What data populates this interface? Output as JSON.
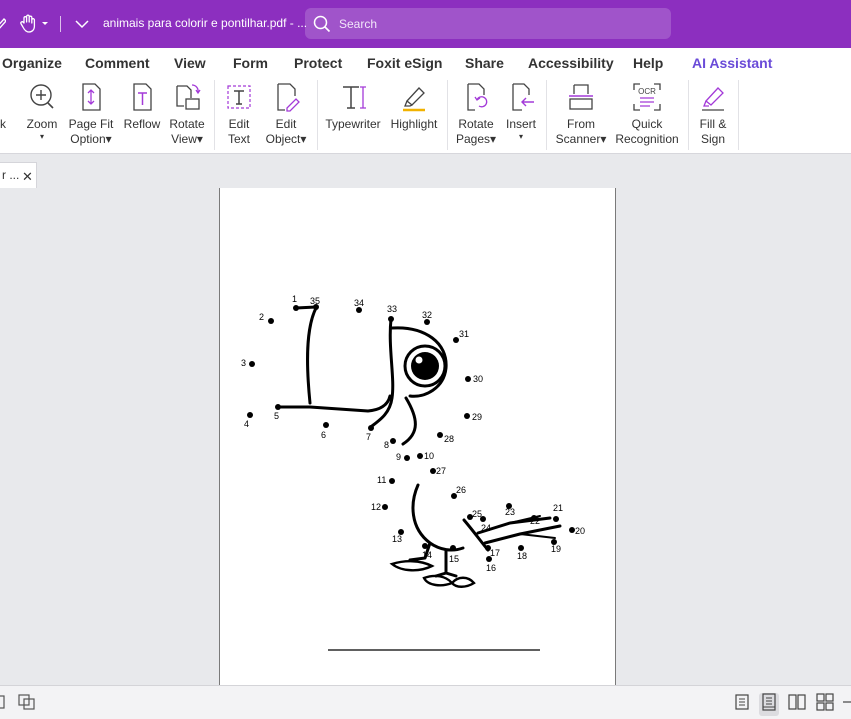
{
  "titlebar": {
    "doc_title": "animais para colorir e pontilhar.pdf - ...",
    "search_placeholder": "Search",
    "bg_color": "#8c2fbf"
  },
  "menu": {
    "tabs": [
      "Organize",
      "Comment",
      "View",
      "Form",
      "Protect",
      "Foxit eSign",
      "Share",
      "Accessibility",
      "Help",
      "AI Assistant"
    ],
    "ai_color": "#6a4bd8"
  },
  "ribbon": {
    "buttons": [
      {
        "icon": "mark-icon",
        "line1": "rk",
        "line2": ""
      },
      {
        "icon": "zoom-icon",
        "line1": "Zoom",
        "line2": "▾"
      },
      {
        "icon": "page-fit-icon",
        "line1": "Page Fit",
        "line2": "Option▾"
      },
      {
        "icon": "reflow-icon",
        "line1": "Reflow",
        "line2": ""
      },
      {
        "icon": "rotate-view-icon",
        "line1": "Rotate",
        "line2": "View▾"
      },
      {
        "icon": "edit-text-icon",
        "line1": "Edit",
        "line2": "Text"
      },
      {
        "icon": "edit-object-icon",
        "line1": "Edit",
        "line2": "Object▾"
      },
      {
        "icon": "typewriter-icon",
        "line1": "Typewriter",
        "line2": ""
      },
      {
        "icon": "highlight-icon",
        "line1": "Highlight",
        "line2": ""
      },
      {
        "icon": "rotate-pages-icon",
        "line1": "Rotate",
        "line2": "Pages▾"
      },
      {
        "icon": "insert-icon",
        "line1": "Insert",
        "line2": "▾"
      },
      {
        "icon": "from-scanner-icon",
        "line1": "From",
        "line2": "Scanner▾"
      },
      {
        "icon": "ocr-icon",
        "line1": "Quick",
        "line2": "Recognition"
      },
      {
        "icon": "fill-sign-icon",
        "line1": "Fill &",
        "line2": "Sign"
      }
    ],
    "ocr_badge": "OCR"
  },
  "doc_tab": {
    "label": "r ...",
    "close": "✕"
  },
  "drawing": {
    "numbers": [
      "1",
      "2",
      "3",
      "4",
      "5",
      "6",
      "7",
      "8",
      "9",
      "10",
      "11",
      "12",
      "13",
      "14",
      "15",
      "16",
      "17",
      "18",
      "19",
      "20",
      "21",
      "22",
      "23",
      "24",
      "25",
      "26",
      "27",
      "28",
      "29",
      "30",
      "31",
      "32",
      "33",
      "34",
      "35"
    ]
  },
  "statusbar": {
    "icons": [
      "single-page-icon",
      "continuous-page-icon",
      "facing-page-icon",
      "continuous-facing-icon"
    ]
  }
}
